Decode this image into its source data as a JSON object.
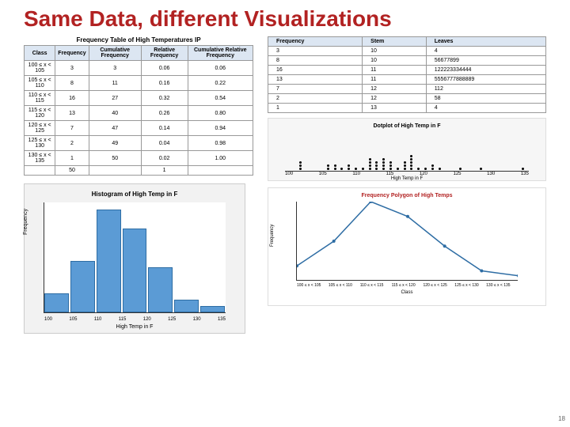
{
  "title": "Same Data, different Visualizations",
  "page_number": "18",
  "freq_table": {
    "caption": "Frequency Table of High Temperatures IP",
    "headers": [
      "Class",
      "Frequency",
      "Cumulative Frequency",
      "Relative Frequency",
      "Cumulative Relative Frequency"
    ],
    "rows": [
      [
        "100 ≤ x < 105",
        "3",
        "3",
        "0.06",
        "0.06"
      ],
      [
        "105 ≤ x < 110",
        "8",
        "11",
        "0.16",
        "0.22"
      ],
      [
        "110 ≤ x < 115",
        "16",
        "27",
        "0.32",
        "0.54"
      ],
      [
        "115 ≤ x < 120",
        "13",
        "40",
        "0.26",
        "0.80"
      ],
      [
        "120 ≤ x < 125",
        "7",
        "47",
        "0.14",
        "0.94"
      ],
      [
        "125 ≤ x < 130",
        "2",
        "49",
        "0.04",
        "0.98"
      ],
      [
        "130 ≤ x < 135",
        "1",
        "50",
        "0.02",
        "1.00"
      ],
      [
        "",
        "50",
        "",
        "1",
        ""
      ]
    ]
  },
  "stem_leaf": {
    "headers": [
      "Frequency",
      "Stem",
      "Leaves"
    ],
    "rows": [
      [
        "3",
        "10",
        "4"
      ],
      [
        "8",
        "10",
        "56677899"
      ],
      [
        "16",
        "11",
        "122223334444"
      ],
      [
        "13",
        "11",
        "5556777888889"
      ],
      [
        "7",
        "12",
        "112"
      ],
      [
        "2",
        "12",
        "58"
      ],
      [
        "1",
        "13",
        "4"
      ]
    ]
  },
  "histogram": {
    "title": "Histogram of High Temp in F",
    "xlabel": "High Temp in F",
    "ylabel": "Frequency",
    "xticks": [
      "100",
      "105",
      "110",
      "115",
      "120",
      "125",
      "130",
      "135"
    ]
  },
  "dotplot": {
    "title": "Dotplot of High Temp in F",
    "xlabel": "High Temp in F",
    "xticks": [
      "100",
      "105",
      "110",
      "115",
      "120",
      "125",
      "130",
      "135"
    ]
  },
  "polygon": {
    "title": "Frequency Polygon of High Temps",
    "ylabel": "Frequency",
    "xlabel": "Class",
    "xticks": [
      "100 ≤ x < 105",
      "105 ≤ x < 110",
      "110 ≤ x < 115",
      "115 ≤ x < 120",
      "120 ≤ x < 125",
      "125 ≤ x < 130",
      "130 ≤ x < 135"
    ]
  },
  "chart_data": [
    {
      "type": "table",
      "name": "frequency_table",
      "columns": [
        "Class",
        "Frequency",
        "Cumulative Frequency",
        "Relative Frequency",
        "Cumulative Relative Frequency"
      ],
      "rows": [
        {
          "class": "100 ≤ x < 105",
          "freq": 3,
          "cum": 3,
          "rel": 0.06,
          "crel": 0.06
        },
        {
          "class": "105 ≤ x < 110",
          "freq": 8,
          "cum": 11,
          "rel": 0.16,
          "crel": 0.22
        },
        {
          "class": "110 ≤ x < 115",
          "freq": 16,
          "cum": 27,
          "rel": 0.32,
          "crel": 0.54
        },
        {
          "class": "115 ≤ x < 120",
          "freq": 13,
          "cum": 40,
          "rel": 0.26,
          "crel": 0.8
        },
        {
          "class": "120 ≤ x < 125",
          "freq": 7,
          "cum": 47,
          "rel": 0.14,
          "crel": 0.94
        },
        {
          "class": "125 ≤ x < 130",
          "freq": 2,
          "cum": 49,
          "rel": 0.04,
          "crel": 0.98
        },
        {
          "class": "130 ≤ x < 135",
          "freq": 1,
          "cum": 50,
          "rel": 0.02,
          "crel": 1.0
        }
      ],
      "total_frequency": 50
    },
    {
      "type": "table",
      "name": "stem_and_leaf",
      "columns": [
        "Frequency",
        "Stem",
        "Leaves"
      ],
      "rows": [
        {
          "freq": 3,
          "stem": 10,
          "leaves": "4"
        },
        {
          "freq": 8,
          "stem": 10,
          "leaves": "56677899"
        },
        {
          "freq": 16,
          "stem": 11,
          "leaves": "122223334444"
        },
        {
          "freq": 13,
          "stem": 11,
          "leaves": "5556777888889"
        },
        {
          "freq": 7,
          "stem": 12,
          "leaves": "112"
        },
        {
          "freq": 2,
          "stem": 12,
          "leaves": "58"
        },
        {
          "freq": 1,
          "stem": 13,
          "leaves": "4"
        }
      ]
    },
    {
      "type": "bar",
      "name": "histogram",
      "title": "Histogram of High Temp in F",
      "xlabel": "High Temp in F",
      "ylabel": "Frequency",
      "categories": [
        "100-105",
        "105-110",
        "110-115",
        "115-120",
        "120-125",
        "125-130",
        "130-135"
      ],
      "values": [
        3,
        8,
        16,
        13,
        7,
        2,
        1
      ],
      "ylim": [
        0,
        16
      ]
    },
    {
      "type": "scatter",
      "name": "dotplot",
      "title": "Dotplot of High Temp in F",
      "xlabel": "High Temp in F",
      "xlim": [
        100,
        135
      ],
      "bin_counts": {
        "102": 3,
        "106": 2,
        "107": 2,
        "108": 1,
        "109": 2,
        "110": 1,
        "111": 1,
        "112": 4,
        "113": 3,
        "114": 4,
        "115": 3,
        "116": 1,
        "117": 3,
        "118": 5,
        "119": 1,
        "120": 1,
        "121": 2,
        "122": 1,
        "125": 1,
        "128": 1,
        "134": 1
      }
    },
    {
      "type": "line",
      "name": "frequency_polygon",
      "title": "Frequency Polygon of High Temps",
      "xlabel": "Class",
      "ylabel": "Frequency",
      "categories": [
        "100 ≤ x < 105",
        "105 ≤ x < 110",
        "110 ≤ x < 115",
        "115 ≤ x < 120",
        "120 ≤ x < 125",
        "125 ≤ x < 130",
        "130 ≤ x < 135"
      ],
      "values": [
        3,
        8,
        16,
        13,
        7,
        2,
        1
      ],
      "ylim": [
        0,
        16
      ]
    }
  ]
}
